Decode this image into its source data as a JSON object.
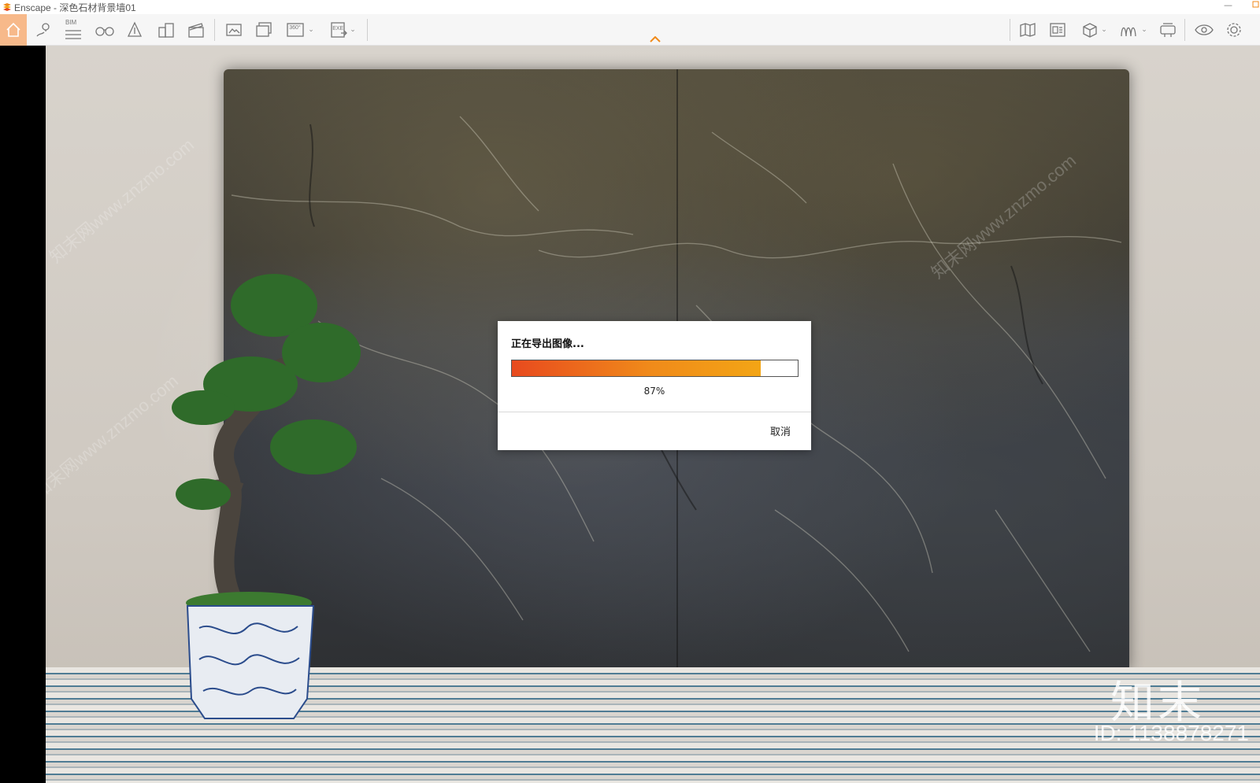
{
  "window": {
    "title": "Enscape - 深色石材背景墙01",
    "logo_icon": "enscape-logo-icon",
    "minimize_glyph": "—"
  },
  "toolbar": {
    "accent_color": "#f7b98a",
    "bim_label": "BIM",
    "pano_label": "360°",
    "exe_label": "EXE",
    "dropdown_glyph": "⌄",
    "collapse_glyph": "^",
    "icons": [
      "home-icon",
      "location-pin-icon",
      "bim-list-icon",
      "binoculars-icon",
      "navigation-icon",
      "buildings-icon",
      "clapperboard-icon",
      "screenshot-icon",
      "batch-render-icon",
      "panorama-360-icon",
      "export-exe-icon",
      "map-icon",
      "window-panel-icon",
      "cube-view-icon",
      "asset-library-icon",
      "vr-headset-icon",
      "eye-icon",
      "settings-icon"
    ]
  },
  "dialog": {
    "title": "正在导出图像...",
    "progress_fraction": 0.87,
    "progress_text": "87%",
    "cancel_label": "取消"
  },
  "watermark": {
    "logo_text": "知末",
    "id_text": "ID: 1138878271",
    "diagonal_text": "知末网www.znzmo.com"
  }
}
